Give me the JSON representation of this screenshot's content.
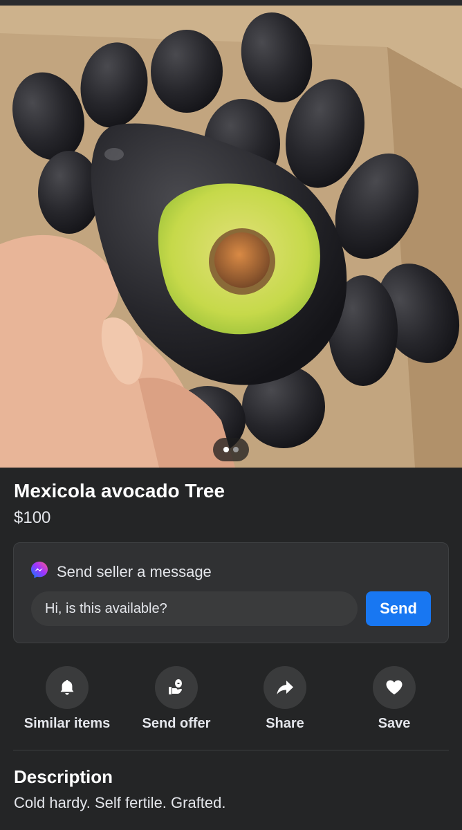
{
  "listing": {
    "title": "Mexicola avocado Tree",
    "price": "$100",
    "photo_icon": "avocado-photo",
    "photo_page": 1,
    "photo_count": 2
  },
  "message": {
    "header": "Send seller a message",
    "icon": "messenger-icon",
    "input_value": "Hi, is this available?",
    "send_label": "Send",
    "accent": "#1877f2"
  },
  "actions": [
    {
      "label": "Similar items",
      "icon": "bell-icon"
    },
    {
      "label": "Send offer",
      "icon": "offer-icon"
    },
    {
      "label": "Share",
      "icon": "share-icon"
    },
    {
      "label": "Save",
      "icon": "heart-icon"
    }
  ],
  "description": {
    "title": "Description",
    "text": "Cold hardy. Self fertile. Grafted."
  }
}
